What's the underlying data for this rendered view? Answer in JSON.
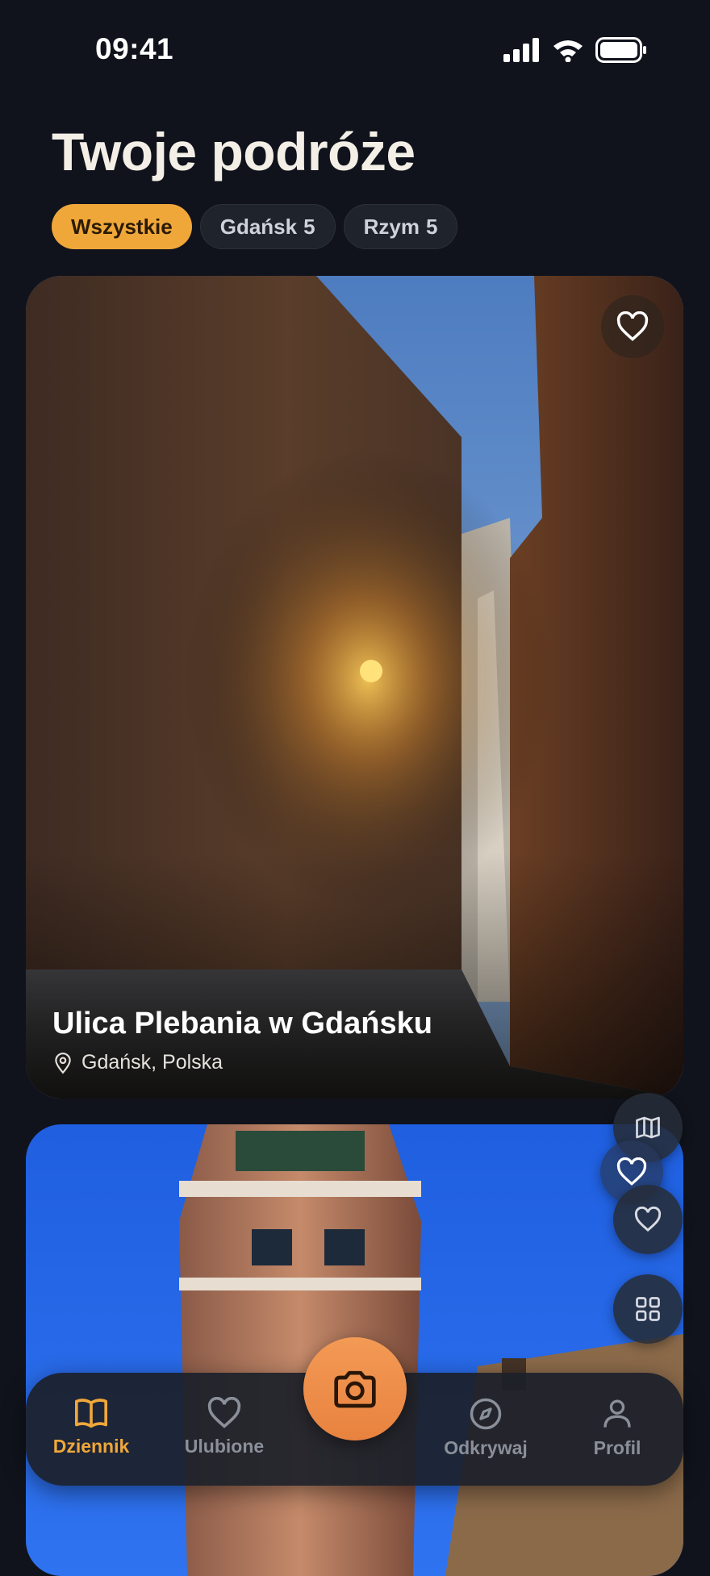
{
  "status_bar": {
    "time": "09:41"
  },
  "header": {
    "title": "Twoje podróże"
  },
  "filters": [
    {
      "label": "Wszystkie",
      "count": "",
      "active": true
    },
    {
      "label": "Gdańsk",
      "count": "5",
      "active": false
    },
    {
      "label": "Rzym",
      "count": "5",
      "active": false
    }
  ],
  "cards": [
    {
      "title": "Ulica Plebania w Gdańsku",
      "location": "Gdańsk, Polska"
    }
  ],
  "tabbar": {
    "items": [
      {
        "label": "Dziennik",
        "icon": "book-icon",
        "active": true
      },
      {
        "label": "Ulubione",
        "icon": "heart-icon",
        "active": false
      },
      {
        "label": "Odkrywaj",
        "icon": "compass-icon",
        "active": false
      },
      {
        "label": "Profil",
        "icon": "person-icon",
        "active": false
      }
    ],
    "center_action_icon": "camera-icon"
  },
  "colors": {
    "accent": "#f0a73a",
    "background": "#10131c",
    "camera": "#ec8a45"
  }
}
